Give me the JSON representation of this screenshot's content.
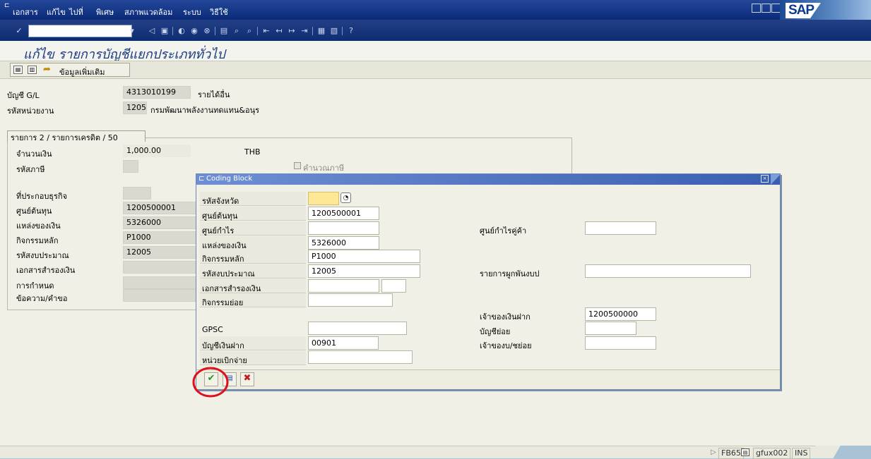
{
  "menu": {
    "items": [
      "เอกสาร",
      "แก้ไข",
      "ไปที่",
      "พิเศษ",
      "สภาพแวดล้อม",
      "ระบบ",
      "วิธีใช้"
    ]
  },
  "logo": {
    "text": "SAP"
  },
  "page": {
    "title": "แก้ไข รายการบัญชีแยกประเภททั่วไป"
  },
  "app_toolbar": {
    "more_label": "ข้อมูลเพิ่มเติม"
  },
  "header": {
    "gl_label": "บัญชี G/L",
    "gl_value": "4313010199",
    "gl_desc": "รายได้อื่น",
    "unit_label": "รหัสหน่วยงาน",
    "unit_value": "1205",
    "unit_desc": "กรมพัฒนาพลังงานทดแทน&อนุร"
  },
  "items": {
    "tab_label": "รายการ 2 / รายการเครดิต / 50",
    "amount_label": "จำนวนเงิน",
    "amount_value": "1,000.00",
    "currency": "THB",
    "tax_label": "รหัสภาษี",
    "calc_tax_label": "คำนวณภาษี",
    "business_area_label": "ที่ประกอบธุรกิจ",
    "cost_center_label": "ศูนย์ต้นทุน",
    "cost_center_value": "1200500001",
    "fund_label": "แหล่งของเงิน",
    "fund_value": "5326000",
    "functional_area_label": "กิจกรรมหลัก",
    "functional_area_value": "P1000",
    "budget_code_label": "รหัสงบประมาณ",
    "budget_code_value": "12005",
    "earmark_label": "เอกสารสำรองเงิน",
    "assignment_label": "การกำหนด",
    "text_label": "ข้อความ/คำขอ"
  },
  "dialog": {
    "title": "Coding Block",
    "fields_left": [
      {
        "label": "รหัสจังหวัด",
        "value": ""
      },
      {
        "label": "ศูนย์ต้นทุน",
        "value": "1200500001"
      },
      {
        "label": "ศูนย์กำไร",
        "value": ""
      },
      {
        "label": "แหล่งของเงิน",
        "value": "5326000"
      },
      {
        "label": "กิจกรรมหลัก",
        "value": "P1000"
      },
      {
        "label": "รหัสงบประมาณ",
        "value": "12005"
      },
      {
        "label": "เอกสารสำรองเงิน",
        "value": ""
      },
      {
        "label": "กิจกรรมย่อย",
        "value": ""
      },
      {
        "label": "GPSC",
        "value": ""
      },
      {
        "label": "บัญชีเงินฝาก",
        "value": "00901"
      },
      {
        "label": "หน่วยเบิกจ่าย",
        "value": ""
      }
    ],
    "fields_right": [
      {
        "label": "ศูนย์กำไรคู่ค้า",
        "value": ""
      },
      {
        "label": "รายการผูกพันงบป",
        "value": ""
      },
      {
        "label": "เจ้าของเงินฝาก",
        "value": "1200500000"
      },
      {
        "label": "บัญชีย่อย",
        "value": ""
      },
      {
        "label": "เจ้าของบ/ชย่อย",
        "value": ""
      }
    ]
  },
  "statusbar": {
    "transaction": "FB65",
    "server": "gfux002",
    "mode": "INS"
  },
  "colors": {
    "menu_bg": "#0a2a77",
    "title_text": "#1a3a84",
    "panel_bg": "#f0f0e6",
    "workspace_bg": "#a9c2d6",
    "highlight_circle": "#e0101a"
  }
}
